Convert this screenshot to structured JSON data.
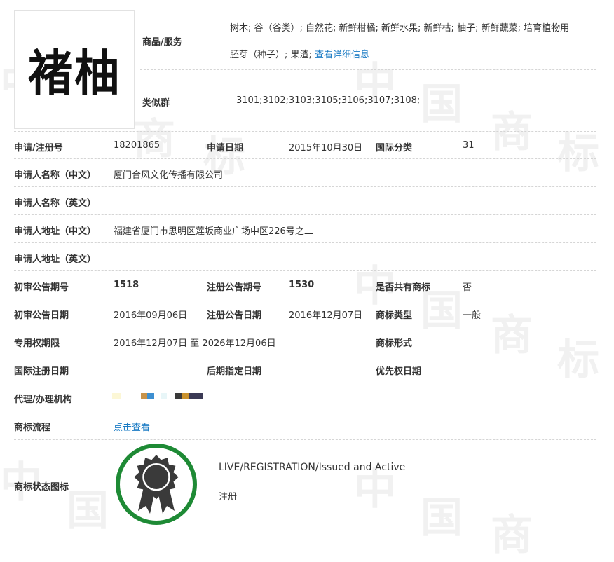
{
  "trademark": {
    "logo_text": "褚柚"
  },
  "goods": {
    "label": "商品/服务",
    "line1": "树木; 谷（谷类）; 自然花; 新鲜柑橘; 新鲜水果; 新鲜枯; 柚子; 新鲜蔬菜; 培育植物用",
    "line2": "胚芽（种子）; 果渣;",
    "detail_link": "查看详细信息"
  },
  "similar_group": {
    "label": "类似群",
    "value": "3101;3102;3103;3105;3106;3107;3108;"
  },
  "fields": {
    "reg_no_label": "申请/注册号",
    "reg_no": "18201865",
    "app_date_label": "申请日期",
    "app_date": "2015年10月30日",
    "intl_class_label": "国际分类",
    "intl_class": "31",
    "applicant_cn_label": "申请人名称（中文）",
    "applicant_cn": "厦门合风文化传播有限公司",
    "applicant_en_label": "申请人名称（英文）",
    "address_cn_label": "申请人地址（中文）",
    "address_cn": "福建省厦门市思明区莲坂商业广场中区226号之二",
    "address_en_label": "申请人地址（英文）",
    "prelim_no_label": "初审公告期号",
    "prelim_no": "1518",
    "reg_pub_no_label": "注册公告期号",
    "reg_pub_no": "1530",
    "shared_label": "是否共有商标",
    "shared": "否",
    "prelim_date_label": "初审公告日期",
    "prelim_date": "2016年09月06日",
    "reg_pub_date_label": "注册公告日期",
    "reg_pub_date": "2016年12月07日",
    "tm_type_label": "商标类型",
    "tm_type": "一般",
    "period_label": "专用权期限",
    "period": "2016年12月07日 至 2026年12月06日",
    "tm_form_label": "商标形式",
    "intl_reg_date_label": "国际注册日期",
    "later_date_label": "后期指定日期",
    "priority_date_label": "优先权日期",
    "agent_label": "代理/办理机构",
    "process_label": "商标流程",
    "process_link": "点击查看",
    "status_icon_label": "商标状态图标",
    "status_en": "LIVE/REGISTRATION/Issued and Active",
    "status_cn": "注册"
  },
  "watermark": {
    "chars": [
      "中",
      "国",
      "商",
      "标"
    ]
  },
  "colors": {
    "link": "#1a7bc4",
    "badge_ring": "#1e8a35",
    "seal": "#3a3a3a"
  },
  "icons": {
    "status_badge": "award-seal-icon"
  }
}
